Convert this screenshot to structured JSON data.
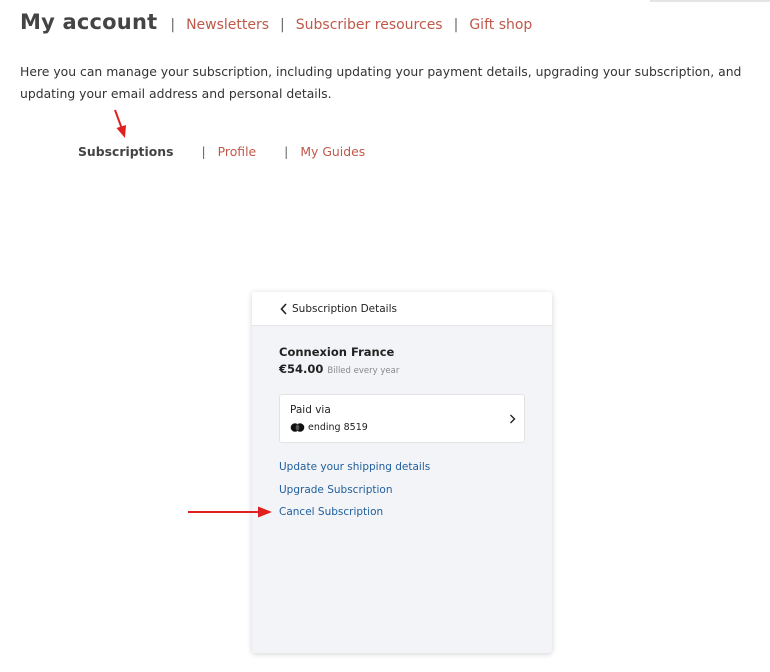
{
  "header": {
    "title": "My account",
    "separator": "|",
    "links": [
      "Newsletters",
      "Subscriber resources",
      "Gift shop"
    ]
  },
  "intro": "Here you can manage your subscription, including updating your payment details, upgrading your subscription, and updating your email address and personal details.",
  "subnav": {
    "active": "Subscriptions",
    "separator": "|",
    "links": [
      "Profile",
      "My Guides"
    ]
  },
  "card": {
    "header_title": "Subscription Details",
    "product_name": "Connexion France",
    "price": "€54.00",
    "billing": "Billed every year",
    "paid_label": "Paid via",
    "card_ending": "ending 8519",
    "actions": [
      "Update your shipping details",
      "Upgrade Subscription",
      "Cancel Subscription"
    ]
  },
  "icons": {
    "back": "chevron-left-icon",
    "open": "chevron-right-icon",
    "card_brand": "mastercard-icon"
  },
  "colors": {
    "link_red": "#c0584a",
    "link_blue": "#1f5e9c",
    "annotation_arrow": "#e02020",
    "card_bg": "#f3f4f7"
  }
}
